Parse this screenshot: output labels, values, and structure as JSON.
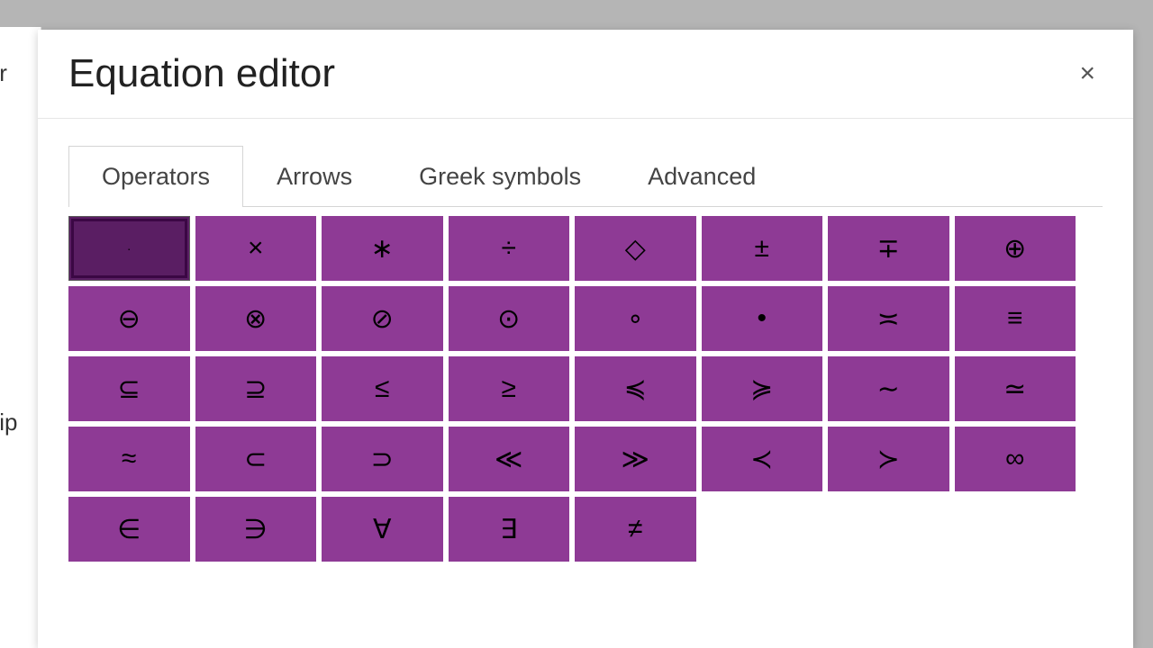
{
  "background": {
    "word1": "tr",
    "word2": ":ip"
  },
  "header": {
    "title": "Equation editor",
    "close_label": "×"
  },
  "tabs": [
    {
      "label": "Operators",
      "active": true
    },
    {
      "label": "Arrows",
      "active": false
    },
    {
      "label": "Greek symbols",
      "active": false
    },
    {
      "label": "Advanced",
      "active": false
    }
  ],
  "symbols": [
    {
      "glyph": "·",
      "name": "cdot",
      "selected": true
    },
    {
      "glyph": "×",
      "name": "times",
      "selected": false
    },
    {
      "glyph": "∗",
      "name": "asterisk",
      "selected": false
    },
    {
      "glyph": "÷",
      "name": "divide",
      "selected": false
    },
    {
      "glyph": "◇",
      "name": "diamond",
      "selected": false
    },
    {
      "glyph": "±",
      "name": "plus-minus",
      "selected": false
    },
    {
      "glyph": "∓",
      "name": "minus-plus",
      "selected": false
    },
    {
      "glyph": "⊕",
      "name": "oplus",
      "selected": false
    },
    {
      "glyph": "⊖",
      "name": "ominus",
      "selected": false
    },
    {
      "glyph": "⊗",
      "name": "otimes",
      "selected": false
    },
    {
      "glyph": "⊘",
      "name": "oslash",
      "selected": false
    },
    {
      "glyph": "⊙",
      "name": "odot",
      "selected": false
    },
    {
      "glyph": "∘",
      "name": "circ",
      "selected": false
    },
    {
      "glyph": "•",
      "name": "bullet",
      "selected": false
    },
    {
      "glyph": "≍",
      "name": "asymp",
      "selected": false
    },
    {
      "glyph": "≡",
      "name": "equiv",
      "selected": false
    },
    {
      "glyph": "⊆",
      "name": "subseteq",
      "selected": false
    },
    {
      "glyph": "⊇",
      "name": "supseteq",
      "selected": false
    },
    {
      "glyph": "≤",
      "name": "leq",
      "selected": false
    },
    {
      "glyph": "≥",
      "name": "geq",
      "selected": false
    },
    {
      "glyph": "≼",
      "name": "preceq",
      "selected": false
    },
    {
      "glyph": "≽",
      "name": "succeq",
      "selected": false
    },
    {
      "glyph": "∼",
      "name": "sim",
      "selected": false
    },
    {
      "glyph": "≃",
      "name": "simeq",
      "selected": false
    },
    {
      "glyph": "≈",
      "name": "approx",
      "selected": false
    },
    {
      "glyph": "⊂",
      "name": "subset",
      "selected": false
    },
    {
      "glyph": "⊃",
      "name": "supset",
      "selected": false
    },
    {
      "glyph": "≪",
      "name": "ll",
      "selected": false
    },
    {
      "glyph": "≫",
      "name": "gg",
      "selected": false
    },
    {
      "glyph": "≺",
      "name": "prec",
      "selected": false
    },
    {
      "glyph": "≻",
      "name": "succ",
      "selected": false
    },
    {
      "glyph": "∞",
      "name": "infty",
      "selected": false
    },
    {
      "glyph": "∈",
      "name": "in",
      "selected": false
    },
    {
      "glyph": "∋",
      "name": "ni",
      "selected": false
    },
    {
      "glyph": "∀",
      "name": "forall",
      "selected": false
    },
    {
      "glyph": "∃",
      "name": "exists",
      "selected": false
    },
    {
      "glyph": "≠",
      "name": "neq",
      "selected": false
    }
  ]
}
